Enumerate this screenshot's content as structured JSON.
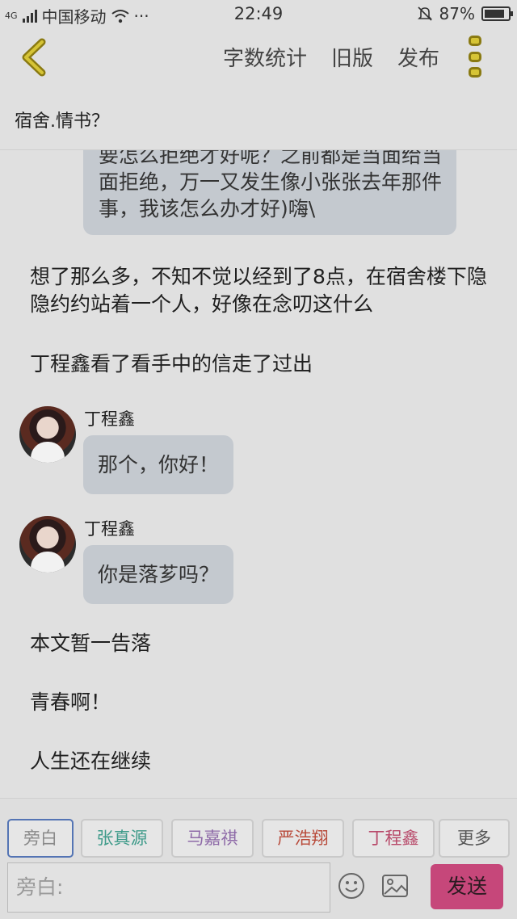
{
  "status_bar": {
    "network": "4G",
    "carrier": "中国移动",
    "dots": "···",
    "time": "22:49",
    "battery": "87%",
    "battery_level": 0.87
  },
  "header": {
    "actions": [
      "字数统计",
      "旧版",
      "发布"
    ]
  },
  "story": {
    "title": "宿舍.情书？"
  },
  "content": {
    "first_bubble": "要怎么拒绝才好呢？之前都是当面给当面拒绝，万一又发生像小张张去年那件事，我该怎么办才好)嗨\\",
    "narration_1": "想了那么多，不知不觉以经到了8点，在宿舍楼下隐隐约约站着一个人，好像在念叨这什么",
    "narration_2": "丁程鑫看了看手中的信走了过出",
    "messages": [
      {
        "name": "丁程鑫",
        "text": "那个，你好！"
      },
      {
        "name": "丁程鑫",
        "text": "你是落芗吗？"
      }
    ],
    "narration_3": "本文暂一告落",
    "narration_4": "青春啊！",
    "narration_5": "人生还在继续"
  },
  "characters": [
    {
      "label": "旁白",
      "color": "#8a8a8a"
    },
    {
      "label": "张真源",
      "color": "#3f9b8a"
    },
    {
      "label": "马嘉祺",
      "color": "#8e6aa8"
    },
    {
      "label": "严浩翔",
      "color": "#b84a3a"
    },
    {
      "label": "丁程鑫",
      "color": "#b84a6a"
    },
    {
      "label": "更多",
      "color": "#555555"
    }
  ],
  "composer": {
    "placeholder": "旁白:",
    "send_label": "发送"
  }
}
